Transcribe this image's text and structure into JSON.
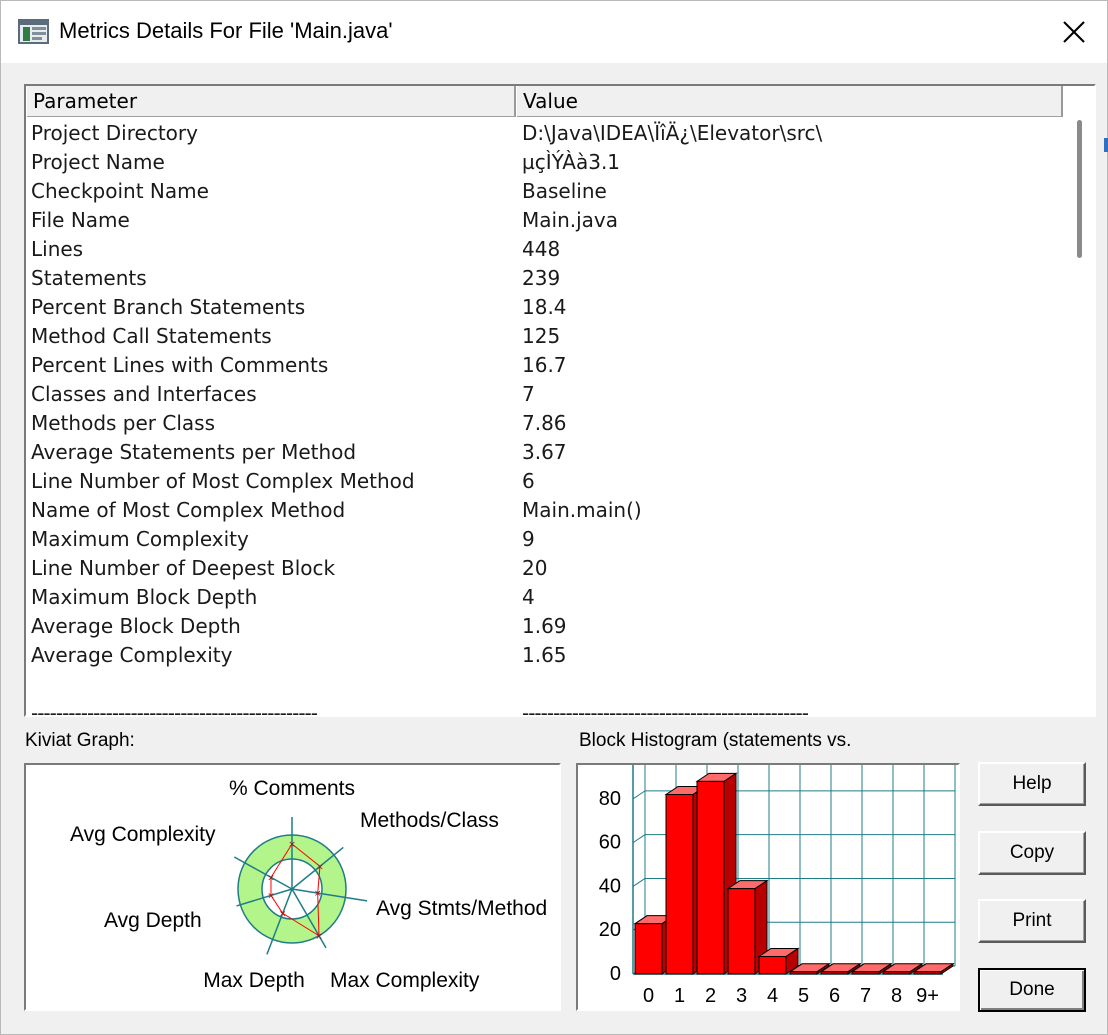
{
  "window": {
    "title": "Metrics Details For File 'Main.java'"
  },
  "table": {
    "headers": {
      "parameter": "Parameter",
      "value": "Value"
    },
    "rows": [
      {
        "parameter": "Project Directory",
        "value": "D:\\Java\\IDEA\\ÏîÄ¿\\Elevator\\src\\"
      },
      {
        "parameter": "Project Name",
        "value": "µçÌÝÀà3.1"
      },
      {
        "parameter": "Checkpoint Name",
        "value": "Baseline"
      },
      {
        "parameter": "File Name",
        "value": "Main.java"
      },
      {
        "parameter": "Lines",
        "value": "448"
      },
      {
        "parameter": "Statements",
        "value": "239"
      },
      {
        "parameter": "Percent Branch Statements",
        "value": "18.4"
      },
      {
        "parameter": "Method Call Statements",
        "value": "125"
      },
      {
        "parameter": "Percent Lines with Comments",
        "value": "16.7"
      },
      {
        "parameter": "Classes and Interfaces",
        "value": "7"
      },
      {
        "parameter": "Methods per Class",
        "value": "7.86"
      },
      {
        "parameter": "Average Statements per Method",
        "value": "3.67"
      },
      {
        "parameter": "Line Number of Most Complex Method",
        "value": "6"
      },
      {
        "parameter": "Name of Most Complex Method",
        "value": "Main.main()"
      },
      {
        "parameter": "Maximum Complexity",
        "value": "9"
      },
      {
        "parameter": "Line Number of Deepest Block",
        "value": "20"
      },
      {
        "parameter": "Maximum Block Depth",
        "value": "4"
      },
      {
        "parameter": "Average Block Depth",
        "value": "1.69"
      },
      {
        "parameter": "Average Complexity",
        "value": "1.65"
      }
    ],
    "separator_param": "----------------------------------------------",
    "separator_value": "----------------------------------------------"
  },
  "kiviat": {
    "label": "Kiviat Graph:",
    "axes": [
      "% Comments",
      "Methods/Class",
      "Avg Stmts/Method",
      "Max Complexity",
      "Max Depth",
      "Avg Depth",
      "Avg Complexity"
    ],
    "colors": {
      "ring": "#b3f58a",
      "axis": "#1f7c87",
      "line": "#ff0000"
    }
  },
  "histogram": {
    "label": "Block Histogram (statements vs.",
    "colors": {
      "bar": "#ff0000",
      "grid": "#1f7c87"
    }
  },
  "chart_data": {
    "type": "bar",
    "title": "Block Histogram (statements vs.",
    "categories": [
      "0",
      "1",
      "2",
      "3",
      "4",
      "5",
      "6",
      "7",
      "8",
      "9+"
    ],
    "values": [
      23,
      82,
      88,
      39,
      8,
      0,
      0,
      0,
      0,
      0
    ],
    "yticks": [
      "0",
      "20",
      "40",
      "60",
      "80"
    ],
    "ylim": [
      0,
      90
    ],
    "grid": true
  },
  "buttons": {
    "help": "Help",
    "copy": "Copy",
    "print": "Print",
    "done": "Done"
  }
}
